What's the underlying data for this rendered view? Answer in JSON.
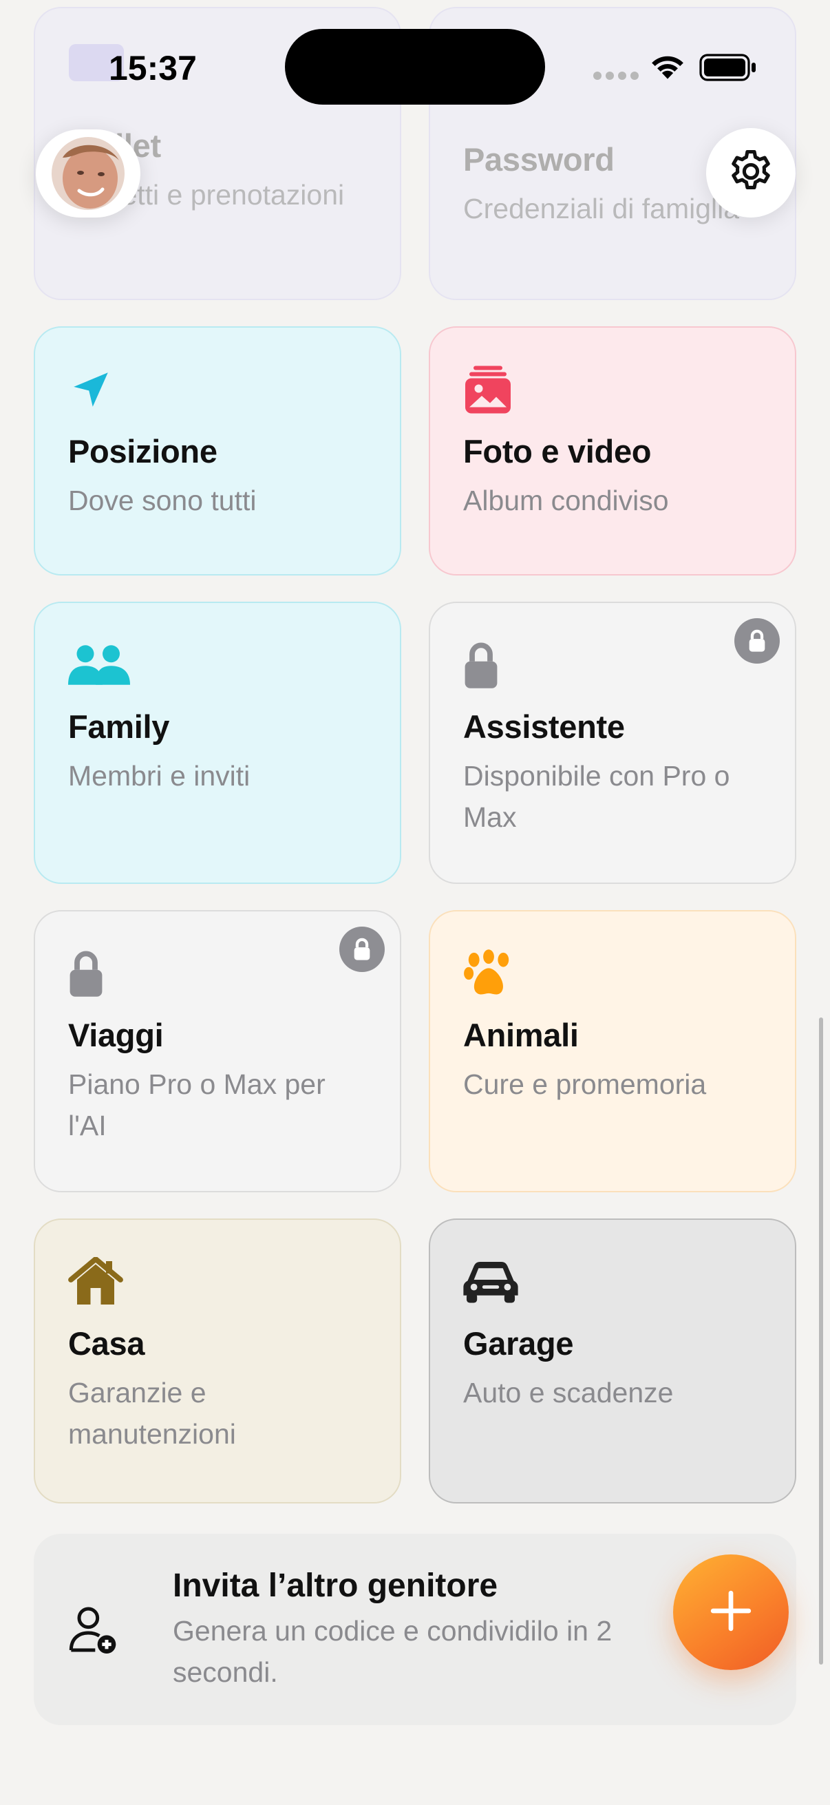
{
  "status": {
    "time": "15:37"
  },
  "cards": {
    "wallet": {
      "title": "Wallet",
      "sub": "Biglietti e prenotazioni"
    },
    "password": {
      "title": "Password",
      "sub": "Credenziali di famiglia"
    },
    "posizione": {
      "title": "Posizione",
      "sub": "Dove sono tutti"
    },
    "foto": {
      "title": "Foto e video",
      "sub": "Album condiviso"
    },
    "family": {
      "title": "Family",
      "sub": "Membri e inviti"
    },
    "assistente": {
      "title": "Assistente",
      "sub": "Disponibile con Pro o Max"
    },
    "viaggi": {
      "title": "Viaggi",
      "sub": "Piano Pro o Max per l'AI"
    },
    "animali": {
      "title": "Animali",
      "sub": "Cure e promemoria"
    },
    "casa": {
      "title": "Casa",
      "sub": "Garanzie e manutenzioni"
    },
    "garage": {
      "title": "Garage",
      "sub": "Auto e scadenze"
    }
  },
  "invite": {
    "title": "Invita l’altro genitore",
    "subtitle": "Genera un codice e condividilo in 2 secondi."
  },
  "colors": {
    "accent_orange": "#f97e2a",
    "posizione": "#1ab8d9",
    "foto": "#f0445e",
    "family": "#1cc3d1",
    "animali": "#ff9f0a",
    "casa": "#8a6a1a",
    "locked": "#8e8e93"
  },
  "icons": {
    "wallet": "ticket-icon",
    "posizione": "location-arrow-icon",
    "foto": "photo-stack-icon",
    "family": "people-icon",
    "assistente": "lock-icon",
    "viaggi": "lock-icon",
    "animali": "paw-icon",
    "casa": "house-icon",
    "garage": "car-icon",
    "invite": "person-add-icon",
    "fab": "plus-icon",
    "settings": "gear-icon"
  }
}
